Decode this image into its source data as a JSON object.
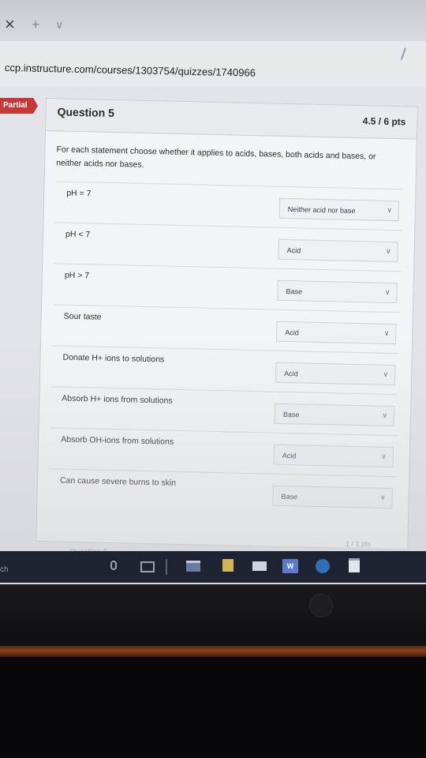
{
  "browser": {
    "close_icon": "×",
    "new_tab_icon": "+",
    "tab_menu_icon": "∨",
    "url": "ccp.instructure.com/courses/1303754/quizzes/1740966"
  },
  "question": {
    "status_badge": "Partial",
    "title": "Question 5",
    "points": "4.5 / 6 pts",
    "prompt": "For each statement choose whether it applies to acids, bases, both acids and bases, or neither acids nor bases.",
    "rows": [
      {
        "label": "pH = 7",
        "answer": "Neither acid nor base"
      },
      {
        "label": "pH < 7",
        "answer": "Acid"
      },
      {
        "label": "pH > 7",
        "answer": "Base"
      },
      {
        "label": "Sour taste",
        "answer": "Acid"
      },
      {
        "label": "Donate H+ ions to solutions",
        "answer": "Acid"
      },
      {
        "label": "Absorb H+ ions from solutions",
        "answer": "Base"
      },
      {
        "label": "Absorb OH-ions from solutions",
        "answer": "Acid"
      },
      {
        "label": "Can cause severe burns to skin",
        "answer": "Base"
      }
    ],
    "chevron": "∨"
  },
  "next_question": {
    "title": "Question 6",
    "points": "1 / 1 pts"
  },
  "taskbar": {
    "search_label": "ch",
    "word_label": "W"
  }
}
